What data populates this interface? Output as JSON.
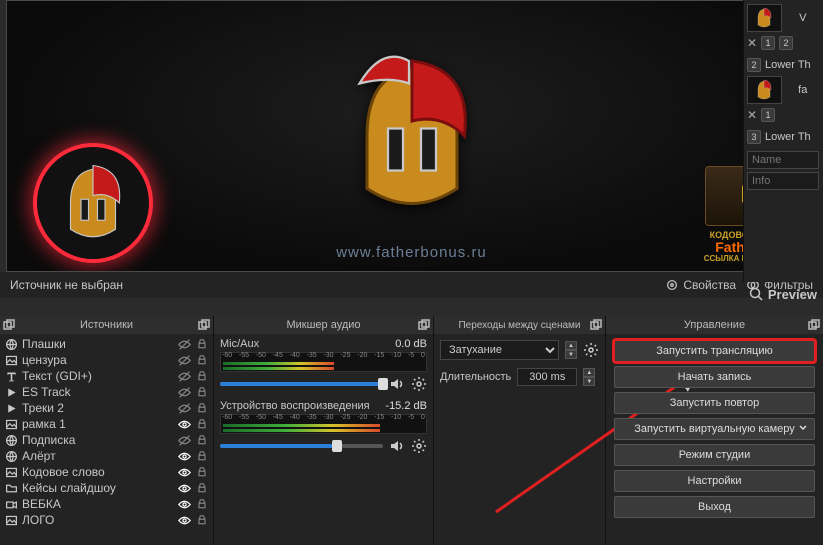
{
  "preview": {
    "url_text": "www.fatherbonus.ru",
    "crate_line1": "КОДОВОЕ СЛОВО",
    "crate_line2": "FatherSon",
    "crate_line3": "ССЫЛКА В ОПИСАНИИ"
  },
  "scene_strip": {
    "groups": [
      {
        "num": "",
        "label": "V",
        "pages": [
          "1",
          "2"
        ],
        "thumb": true
      },
      {
        "num": "2",
        "label": "Lower Th",
        "pages": [
          "1"
        ],
        "thumb": true,
        "caption": "fa"
      },
      {
        "num": "3",
        "label": "Lower Th",
        "inputs": [
          "Name",
          "Info"
        ]
      }
    ]
  },
  "under_toolbar": {
    "no_source_selected": "Источник не выбран",
    "properties": "Свойства",
    "filters": "Фильтры",
    "preview_btn": "Preview"
  },
  "sources_dock": {
    "title": "Источники",
    "items": [
      {
        "icon": "globe",
        "name": "Плашки",
        "visible": false
      },
      {
        "icon": "image",
        "name": "цензура",
        "visible": false
      },
      {
        "icon": "text",
        "name": "Текст (GDI+)",
        "visible": false
      },
      {
        "icon": "play",
        "name": "ES Track",
        "visible": false
      },
      {
        "icon": "play",
        "name": "Треки 2",
        "visible": false
      },
      {
        "icon": "image",
        "name": "рамка 1",
        "visible": true
      },
      {
        "icon": "globe",
        "name": "Подписка",
        "visible": false
      },
      {
        "icon": "globe",
        "name": "Алёрт",
        "visible": true
      },
      {
        "icon": "image",
        "name": "Кодовое слово",
        "visible": true
      },
      {
        "icon": "folder",
        "name": "Кейсы слайдшоу",
        "visible": true
      },
      {
        "icon": "camera",
        "name": "ВЕБКА",
        "visible": true
      },
      {
        "icon": "image",
        "name": "ЛОГО",
        "visible": true
      }
    ]
  },
  "mixer_dock": {
    "title": "Микшер аудио",
    "scale": [
      "-60",
      "-55",
      "-50",
      "-45",
      "-40",
      "-35",
      "-30",
      "-25",
      "-20",
      "-15",
      "-10",
      "-5",
      "0"
    ],
    "channels": [
      {
        "name": "Mic/Aux",
        "db": "0.0 dB",
        "vol_pct": 100,
        "meter_pct": 55
      },
      {
        "name": "Устройство воспроизведения",
        "db": "-15.2 dB",
        "vol_pct": 72,
        "meter_pct": 78
      }
    ]
  },
  "transitions_dock": {
    "title": "Переходы между сценами",
    "fade_label": "Затухание",
    "duration_label": "Длительность",
    "duration_value": "300 ms"
  },
  "controls_dock": {
    "title": "Управление",
    "buttons": [
      {
        "label": "Запустить трансляцию",
        "highlight": true
      },
      {
        "label": "Начать запись"
      },
      {
        "label": "Запустить повтор"
      },
      {
        "label": "Запустить виртуальную камеру",
        "chev": true
      },
      {
        "label": "Режим студии"
      },
      {
        "label": "Настройки"
      },
      {
        "label": "Выход"
      }
    ]
  }
}
